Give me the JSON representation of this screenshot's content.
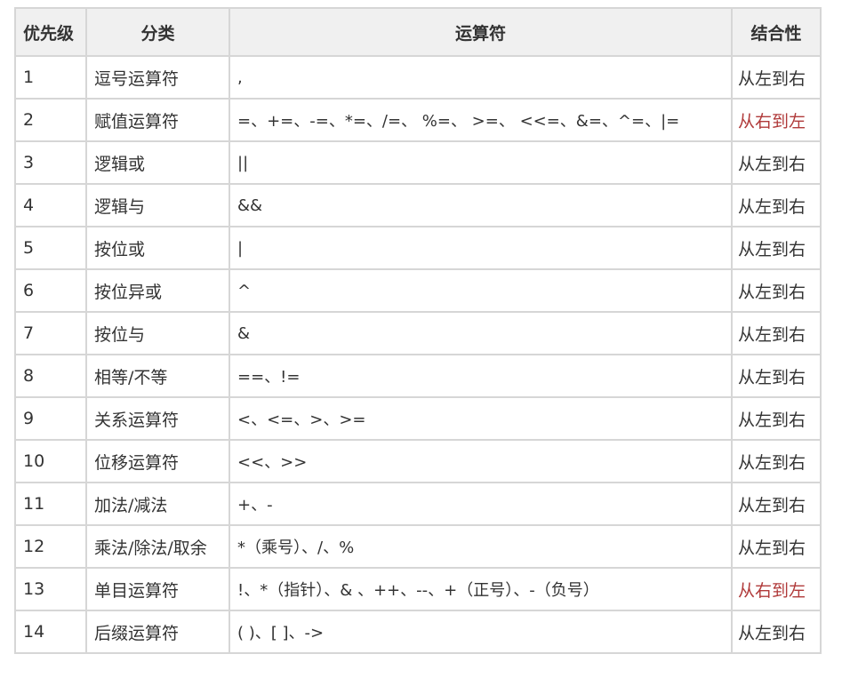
{
  "table": {
    "headers": {
      "priority": "优先级",
      "category": "分类",
      "operators": "运算符",
      "associativity": "结合性"
    },
    "rows": [
      {
        "priority": "1",
        "category": "逗号运算符",
        "operators": ",",
        "associativity": "从左到右",
        "rtl": false
      },
      {
        "priority": "2",
        "category": "赋值运算符",
        "operators": "=、+=、-=、*=、/=、 %=、 >=、 <<=、&=、^=、|=",
        "associativity": "从右到左",
        "rtl": true
      },
      {
        "priority": "3",
        "category": "逻辑或",
        "operators": "||",
        "associativity": "从左到右",
        "rtl": false
      },
      {
        "priority": "4",
        "category": "逻辑与",
        "operators": "&&",
        "associativity": "从左到右",
        "rtl": false
      },
      {
        "priority": "5",
        "category": "按位或",
        "operators": "|",
        "associativity": "从左到右",
        "rtl": false
      },
      {
        "priority": "6",
        "category": "按位异或",
        "operators": "^",
        "associativity": "从左到右",
        "rtl": false
      },
      {
        "priority": "7",
        "category": "按位与",
        "operators": "&",
        "associativity": "从左到右",
        "rtl": false
      },
      {
        "priority": "8",
        "category": "相等/不等",
        "operators": "==、!=",
        "associativity": "从左到右",
        "rtl": false
      },
      {
        "priority": "9",
        "category": "关系运算符",
        "operators": "<、<=、>、>=",
        "associativity": "从左到右",
        "rtl": false
      },
      {
        "priority": "10",
        "category": "位移运算符",
        "operators": "<<、>>",
        "associativity": "从左到右",
        "rtl": false
      },
      {
        "priority": "11",
        "category": "加法/减法",
        "operators": "+、-",
        "associativity": "从左到右",
        "rtl": false
      },
      {
        "priority": "12",
        "category": "乘法/除法/取余",
        "operators": "*（乘号）、/、%",
        "associativity": "从左到右",
        "rtl": false
      },
      {
        "priority": "13",
        "category": "单目运算符",
        "operators": "!、*（指针）、& 、++、--、+（正号）、-（负号）",
        "associativity": "从右到左",
        "rtl": true
      },
      {
        "priority": "14",
        "category": "后缀运算符",
        "operators": "( )、[ ]、->",
        "associativity": "从左到右",
        "rtl": false
      }
    ]
  },
  "colors": {
    "header_bg": "#f0f0f0",
    "border": "#d6d6d6",
    "text": "#333333",
    "rtl_text": "#b03a3a"
  }
}
